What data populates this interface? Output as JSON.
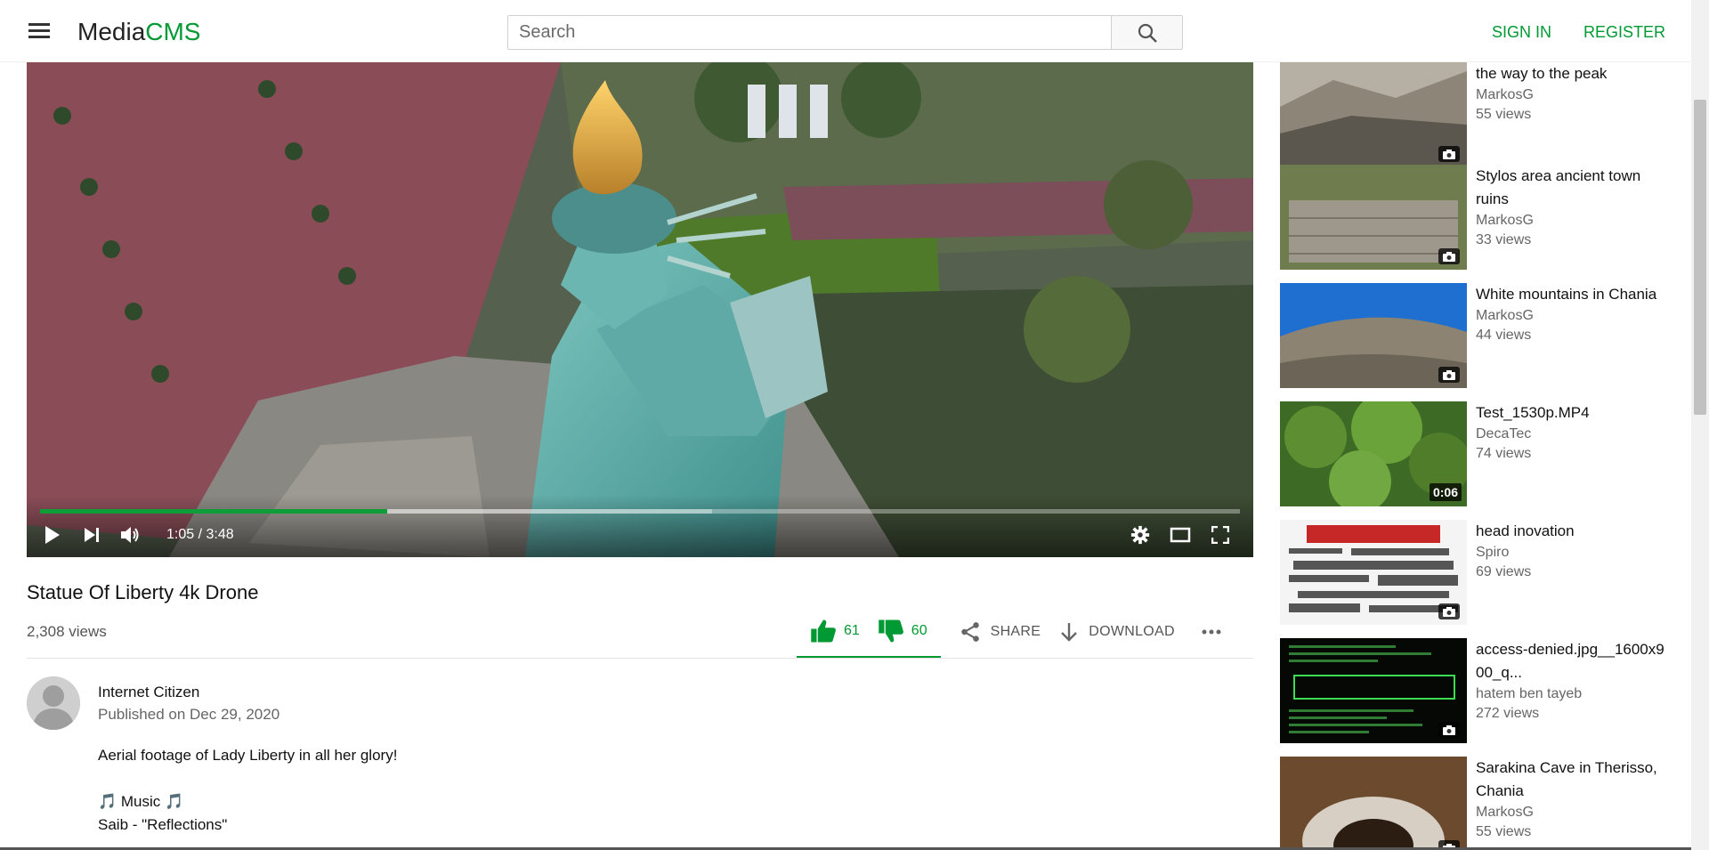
{
  "header": {
    "logo_media": "Media",
    "logo_cms": "CMS",
    "search_placeholder": "Search",
    "sign_in": "SIGN IN",
    "register": "REGISTER",
    "accent": "#009933"
  },
  "player": {
    "time": "1:05 / 3:48",
    "progress": 0.289,
    "buffered": 0.56
  },
  "video": {
    "title": "Statue Of Liberty 4k Drone",
    "views": "2,308 views",
    "likes": "61",
    "dislikes": "60",
    "share": "SHARE",
    "download": "DOWNLOAD",
    "author": "Internet Citizen",
    "published": "Published on Dec 29, 2020",
    "description_line1": "Aerial footage of Lady Liberty in all her glory!",
    "music_line": "🎵 Music 🎵",
    "music_credit": "Saib - \"Reflections\""
  },
  "related": [
    {
      "title": "White mountains Chania, on the way to the peak",
      "author": "MarkosG",
      "views": "55 views",
      "badge": "camera-icon"
    },
    {
      "title": "Stylos area ancient town ruins",
      "author": "MarkosG",
      "views": "33 views",
      "badge": "camera-icon"
    },
    {
      "title": "White mountains in Chania",
      "author": "MarkosG",
      "views": "44 views",
      "badge": "camera-icon"
    },
    {
      "title": "Test_1530p.MP4",
      "author": "DecaTec",
      "views": "74 views",
      "duration": "0:06"
    },
    {
      "title": "head inovation",
      "author": "Spiro",
      "views": "69 views",
      "badge": "camera-icon"
    },
    {
      "title": "access-denied.jpg__1600x900_q...",
      "author": "hatem ben tayeb",
      "views": "272 views",
      "badge": "camera-icon"
    },
    {
      "title": "Sarakina Cave in Therisso, Chania",
      "author": "MarkosG",
      "views": "55 views",
      "badge": "camera-icon"
    }
  ]
}
